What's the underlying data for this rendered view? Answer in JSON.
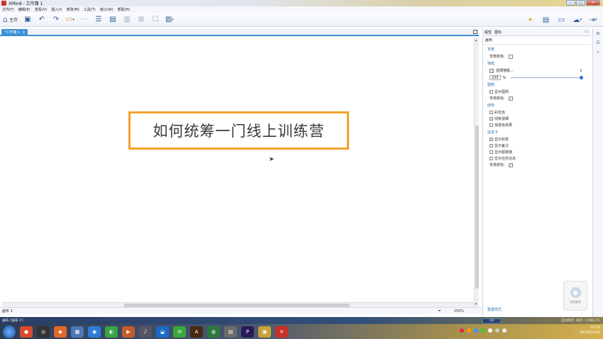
{
  "window": {
    "title": "XMind - 工作簿 1"
  },
  "menu": [
    "文件(F)",
    "编辑(E)",
    "查看(V)",
    "插入(I)",
    "修改(M)",
    "工具(T)",
    "窗口(W)",
    "帮助(H)"
  ],
  "toolbar": {
    "home_label": "主页"
  },
  "tab": {
    "label": "*工作簿 1",
    "close": "×"
  },
  "canvas": {
    "central_topic": "如何统筹一门线上训练营"
  },
  "sheetbar": {
    "sheet_name": "画布 1",
    "zoom": "150%"
  },
  "panel": {
    "tabs": [
      "属性",
      "图标"
    ],
    "heading": "画布",
    "sections": {
      "background": {
        "title": "背景",
        "color_label": "背景颜色:"
      },
      "wallpaper": {
        "title": "墙纸",
        "select_label": "选择墙纸...",
        "opacity_value": "100",
        "opacity_unit": "%"
      },
      "legend": {
        "title": "图例",
        "show_legend": "显示图例",
        "bg_color_label": "背景颜色:"
      },
      "structure": {
        "title": "结构",
        "rainbow": "彩虹色",
        "taper_lines": "线条渐细",
        "gradient": "渐变色效果"
      },
      "infocard": {
        "title": "信息卡",
        "show_labels": "显示标签",
        "show_notes": "显示备注",
        "show_hyperlinks": "显示超链接",
        "show_task_info": "显示任务信息",
        "bg_color_label": "背景颜色:"
      }
    },
    "reset_link": "重置样式"
  },
  "checkboxes": {
    "show_legend": false,
    "rainbow": false,
    "taper_lines": true,
    "gradient": false,
    "show_labels": true,
    "show_notes": false,
    "show_hyperlinks": false,
    "show_task_info": false
  },
  "voice": {
    "label": "点击说话"
  },
  "status": {
    "left": "画布 ('画布 1')",
    "mid": "CH",
    "right": "自动保存: 关闭 · CONG PC"
  },
  "clock": {
    "time": "19:25",
    "date": "2019/10/25"
  },
  "colors": {
    "accent": "#3d8fd6",
    "topic_border": "#f2a22a"
  }
}
